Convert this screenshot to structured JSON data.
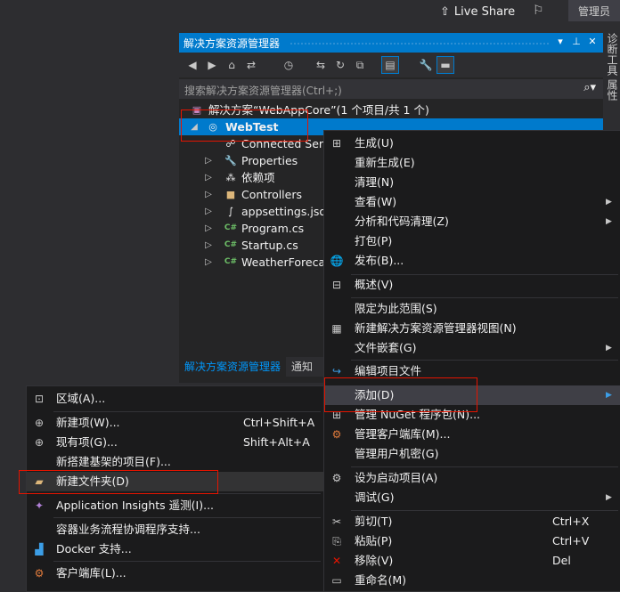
{
  "topbar": {
    "live_share_label": "Live Share",
    "admin_label": "管理员"
  },
  "solution_explorer": {
    "title": "解决方案资源管理器",
    "search_placeholder": "搜索解决方案资源管理器(Ctrl+;)",
    "solution_label": "解决方案“WebAppCore”(1 个项目/共 1 个)",
    "project_label": "WebTest",
    "items": [
      {
        "label": "Connected Servi"
      },
      {
        "label": "Properties"
      },
      {
        "label": "依赖项"
      },
      {
        "label": "Controllers"
      },
      {
        "label": "appsettings.json"
      },
      {
        "label": "Program.cs"
      },
      {
        "label": "Startup.cs"
      },
      {
        "label": "WeatherForecas"
      }
    ],
    "tabs": {
      "explorer": "解决方案资源管理器",
      "notifications": "通知"
    }
  },
  "side_tabs": {
    "text": "诊断工具  属性"
  },
  "context_menu": {
    "build": "生成(U)",
    "rebuild": "重新生成(E)",
    "clean": "清理(N)",
    "view": "查看(W)",
    "analyze": "分析和代码清理(Z)",
    "pack": "打包(P)",
    "publish": "发布(B)...",
    "overview": "概述(V)",
    "scope": "限定为此范围(S)",
    "new_view": "新建解决方案资源管理器视图(N)",
    "file_nesting": "文件嵌套(G)",
    "edit_project": "编辑项目文件",
    "add": "添加(D)",
    "nuget": "管理 NuGet 程序包(N)...",
    "client_libs": "管理客户端库(M)...",
    "user_secrets": "管理用户机密(G)",
    "set_startup": "设为启动项目(A)",
    "debug": "调试(G)",
    "cut": "剪切(T)",
    "cut_sc": "Ctrl+X",
    "paste": "粘贴(P)",
    "paste_sc": "Ctrl+V",
    "remove": "移除(V)",
    "remove_sc": "Del",
    "rename": "重命名(M)"
  },
  "add_submenu": {
    "area": "区域(A)...",
    "new_item": "新建项(W)...",
    "new_item_sc": "Ctrl+Shift+A",
    "existing_item": "现有项(G)...",
    "existing_item_sc": "Shift+Alt+A",
    "scaffold": "新搭建基架的项目(F)...",
    "new_folder": "新建文件夹(D)",
    "app_insights": "Application Insights 遥测(I)...",
    "orchestration": "容器业务流程协调程序支持...",
    "docker": "Docker 支持...",
    "client_lib": "客户端库(L)..."
  },
  "colors": {
    "accent": "#007acc",
    "highlight_border": "#e51400",
    "menu_bg": "#1b1b1c",
    "background": "#2d2d30"
  }
}
